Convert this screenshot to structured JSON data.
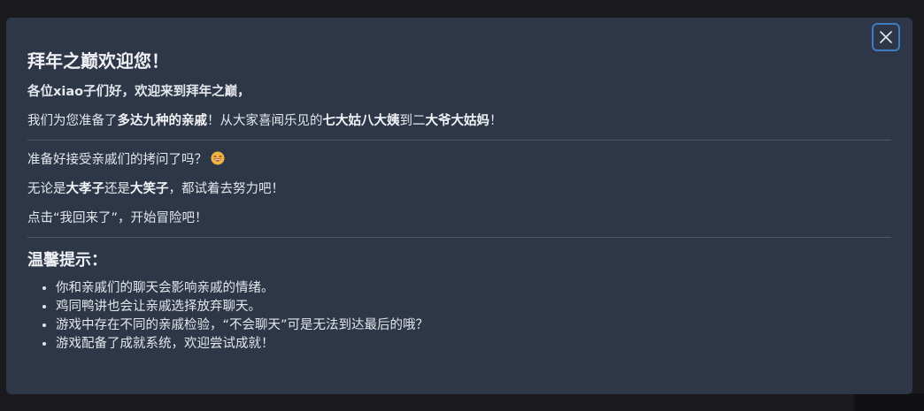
{
  "modal": {
    "title": "拜年之巅欢迎您！",
    "greeting": "各位xiao子们好，欢迎来到拜年之巅，",
    "intro": {
      "part1": "我们为您准备了",
      "bold1": "多达九种的亲戚",
      "part2": "！从大家喜闻乐见的",
      "bold2": "七大姑八大姨",
      "part3": "到二",
      "bold3": "大爷大姑妈",
      "part4": "！"
    },
    "line1": "准备好接受亲戚们的拷问了吗？",
    "line1_emoji": "😄",
    "line2": {
      "part1": "无论是",
      "bold1": "大孝子",
      "part2": "还是",
      "bold2": "大笑子",
      "part3": "，都试着去努力吧！"
    },
    "line3": "点击“我回来了”，开始冒险吧！",
    "tips_title": "温馨提示：",
    "tips": [
      "你和亲戚们的聊天会影响亲戚的情绪。",
      "鸡同鸭讲也会让亲戚选择放弃聊天。",
      "游戏中存在不同的亲戚检验，“不会聊天”可是无法到达最后的哦？",
      "游戏配备了成就系统，欢迎尝试成就！"
    ],
    "close_icon": "close-icon"
  },
  "colors": {
    "modal_bg": "#2e3748",
    "page_bg": "#1a191e",
    "close_border": "#3d7bc4",
    "text": "#e4e7ec"
  }
}
